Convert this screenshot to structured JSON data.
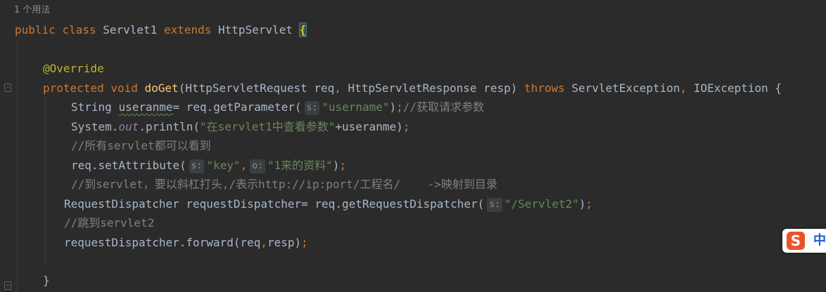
{
  "editor": {
    "usage_hint": "1 个用法",
    "lines": {
      "l1": {
        "kw1": "public",
        "kw2": "class",
        "name": "Servlet1",
        "kw3": "extends",
        "parent": "HttpServlet",
        "brace": "{"
      },
      "l2": {
        "annotation": "@Override"
      },
      "l3": {
        "kw1": "protected",
        "kw2": "void",
        "method": "doGet",
        "sig1": "(HttpServletRequest req",
        "comma": ",",
        "sig2": " HttpServletResponse resp)",
        "kw3": "throws",
        "exc": "ServletException",
        "comma2": ",",
        "exc2": " IOException {"
      },
      "l4": {
        "type": "String ",
        "var": "useranme",
        "rest": "= req.getParameter(",
        "hint": "s:",
        "str": "\"username\"",
        "close": ")",
        "semi": ";",
        "comment": "//获取请求参数"
      },
      "l5": {
        "sys": "System.",
        "out": "out",
        "print": ".println(",
        "str": "\"在servlet1中查看参数\"",
        "rest": "+useranme)",
        "semi": ";"
      },
      "l6": {
        "comment": "//所有servlet都可以看到"
      },
      "l7": {
        "call": "req.setAttribute(",
        "hint1": "s:",
        "str1": "\"key\"",
        "comma": ",",
        "hint2": "o:",
        "str2": "\"1来的资料\"",
        "close": ")",
        "semi": ";"
      },
      "l8": {
        "comment": "//到servlet，要以斜杠打头,/表示http://ip:port/工程名/    ->映射到目录"
      },
      "l9": {
        "decl": "RequestDispatcher requestDispatcher= req.getRequestDispatcher(",
        "hint": "s:",
        "str": "\"/Servlet2\"",
        "close": ")",
        "semi": ";"
      },
      "l10": {
        "comment": "//跳到servlet2"
      },
      "l11": {
        "call": "requestDispatcher.forward(req",
        "comma": ",",
        "rest": "resp)",
        "semi": ";"
      },
      "l12": {
        "brace": "}"
      }
    }
  },
  "ime": {
    "logo": "S",
    "label": "中"
  },
  "colors": {
    "background": "#2b2b2b",
    "keyword": "#cc7832",
    "string": "#6a8759",
    "comment": "#808080",
    "method": "#ffc66d",
    "annotation": "#bbb529",
    "default": "#a9b7c6"
  }
}
